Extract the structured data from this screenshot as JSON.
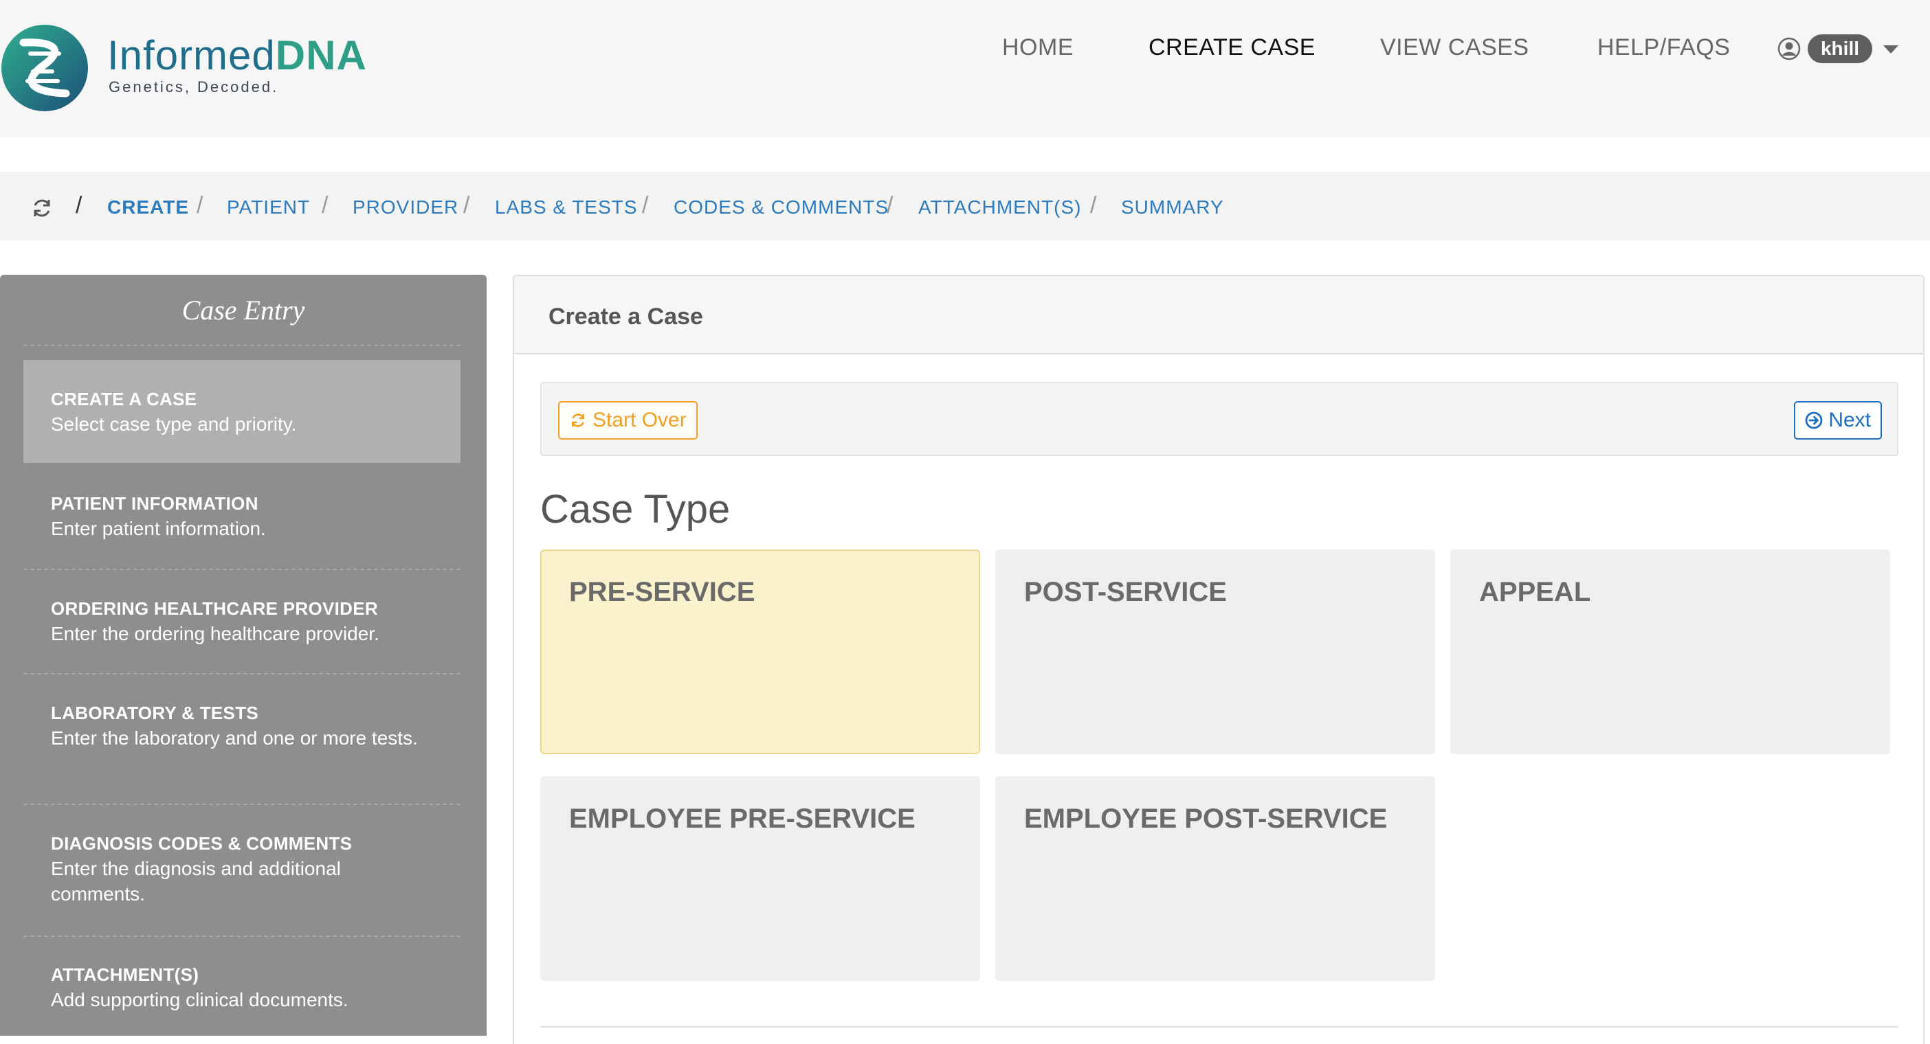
{
  "header": {
    "brand_part1": "Informed",
    "brand_part2": "DNA",
    "tagline": "Genetics, Decoded.",
    "nav": [
      {
        "label": "HOME"
      },
      {
        "label": "CREATE CASE"
      },
      {
        "label": "VIEW CASES"
      },
      {
        "label": "HELP/FAQS"
      }
    ],
    "user": "khill",
    "icons": {
      "user": "user-circle-icon",
      "menu": "caret-down-icon"
    }
  },
  "breadcrumb": {
    "icon": "refresh-icon",
    "items": [
      {
        "label": "CREATE"
      },
      {
        "label": "PATIENT"
      },
      {
        "label": "PROVIDER"
      },
      {
        "label": "LABS & TESTS"
      },
      {
        "label": "CODES & COMMENTS"
      },
      {
        "label": "ATTACHMENT(S)"
      },
      {
        "label": "SUMMARY"
      }
    ],
    "separator": "/"
  },
  "sidebar": {
    "title": "Case Entry",
    "items": [
      {
        "title": "CREATE A CASE",
        "desc": "Select case type and priority."
      },
      {
        "title": "PATIENT INFORMATION",
        "desc": "Enter patient information."
      },
      {
        "title": "ORDERING HEALTHCARE PROVIDER",
        "desc": "Enter the ordering healthcare provider."
      },
      {
        "title": "LABORATORY & TESTS",
        "desc": "Enter the laboratory and one or more tests."
      },
      {
        "title": "DIAGNOSIS CODES & COMMENTS",
        "desc": "Enter the diagnosis and additional comments."
      },
      {
        "title": "ATTACHMENT(S)",
        "desc": "Add supporting clinical documents."
      }
    ]
  },
  "main": {
    "panel_title": "Create a Case",
    "start_over": "Start Over",
    "next": "Next",
    "section_title": "Case Type",
    "case_types": [
      {
        "label": "PRE-SERVICE",
        "selected": true
      },
      {
        "label": "POST-SERVICE",
        "selected": false
      },
      {
        "label": "APPEAL",
        "selected": false
      },
      {
        "label": "EMPLOYEE PRE-SERVICE",
        "selected": false
      },
      {
        "label": "EMPLOYEE POST-SERVICE",
        "selected": false
      }
    ]
  },
  "colors": {
    "link_blue": "#2c7bbf",
    "brand_teal": "#2e9e86",
    "brand_blue": "#1f6e8c",
    "warning_orange": "#f0a024",
    "selected_tile": "#faf2cd",
    "sidebar_gray": "#8e8e8e"
  }
}
